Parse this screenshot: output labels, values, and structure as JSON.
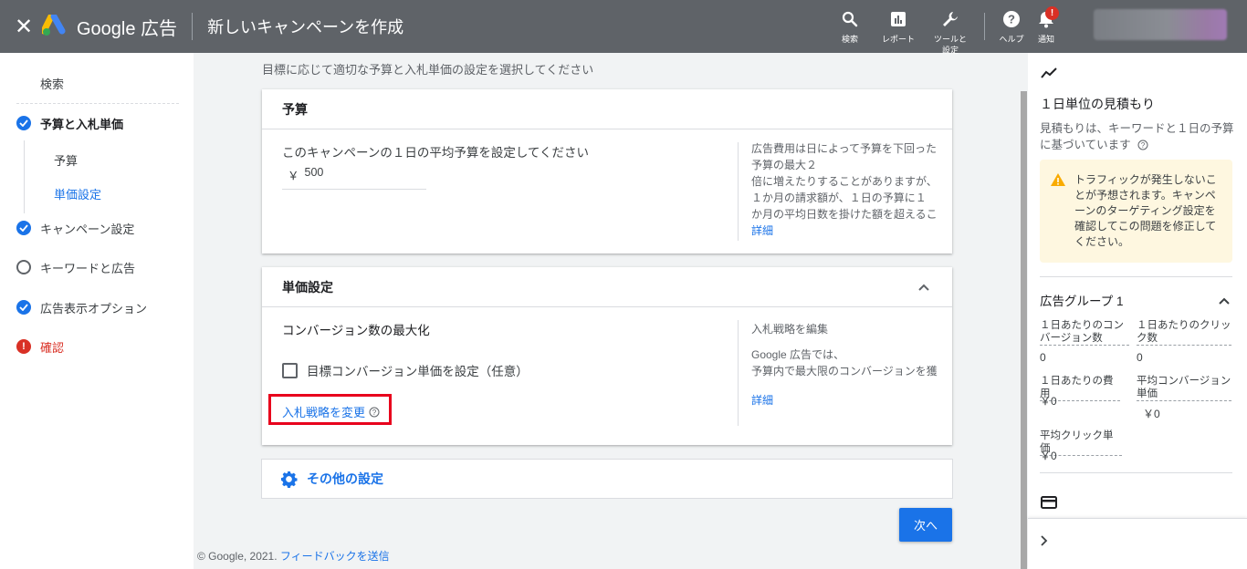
{
  "header": {
    "close_label": "✕",
    "brand": "Google 広告",
    "title": "新しいキャンペーンを作成",
    "tools": [
      {
        "label": "検索",
        "icon": "search-icon"
      },
      {
        "label": "レポート",
        "icon": "reports-icon"
      },
      {
        "label": "ツールと\n設定",
        "icon": "wrench-icon"
      },
      {
        "label": "ヘルプ",
        "icon": "help-icon"
      },
      {
        "label": "通知",
        "icon": "bell-icon"
      }
    ],
    "notification_badge": "!"
  },
  "sidebar": {
    "items": [
      {
        "label": "検索",
        "state": "none"
      },
      {
        "label": "予算と入札単価",
        "state": "done"
      },
      {
        "label": "予算",
        "state": "sub"
      },
      {
        "label": "単価設定",
        "state": "sub-active"
      },
      {
        "label": "キャンペーン設定",
        "state": "done"
      },
      {
        "label": "キーワードと広告",
        "state": "empty"
      },
      {
        "label": "広告表示オプション",
        "state": "done"
      },
      {
        "label": "確認",
        "state": "error"
      }
    ],
    "error_mark": "!"
  },
  "main": {
    "subtitle": "目標に応じて適切な予算と入札単価の設定を選択してください",
    "budget": {
      "title": "予算",
      "prompt": "このキャンペーンの１日の平均予算を設定してください",
      "currency": "￥",
      "value": "500",
      "note_lines": [
        "広告費用は日によって予算を下回った",
        "予算の最大２",
        "倍に増えたりすることがありますが、",
        "１か月の請求額が、１日の予算に１",
        "か月の平均日数を掛けた額を超えるこ"
      ],
      "note_link": "詳細"
    },
    "bidding": {
      "title": "単価設定",
      "strategy": "コンバージョン数の最大化",
      "checkbox_label": "目標コンバージョン単価を設定（任意）",
      "change_link": "入札戦略を変更",
      "note_title": "入札戦略を編集",
      "note_lines": [
        "Google 広告では、",
        "予算内で最大限のコンバージョンを獲"
      ],
      "note_link": "詳細"
    },
    "other_settings": "その他の設定",
    "next_button": "次へ",
    "footer_copyright": "© Google, 2021.",
    "footer_feedback": "フィードバックを送信"
  },
  "right_panel": {
    "title": "１日単位の見積もり",
    "description": "見積もりは、キーワードと１日の予算に基づいています",
    "warning": "トラフィックが発生しないことが予想されます。キャンペーンのターゲティング設定を確認してこの問題を修正してください。",
    "group_title": "広告グループ 1",
    "metrics": [
      {
        "label": "１日あたりのコンバージョン数",
        "value": "0"
      },
      {
        "label": "１日あたりのクリック数",
        "value": "0"
      },
      {
        "label": "１日あたりの費用",
        "value": "￥0"
      },
      {
        "label": "平均コンバージョン単価",
        "value": "￥0"
      },
      {
        "label": "平均クリック単価",
        "value": "￥0"
      }
    ]
  },
  "colors": {
    "header_bg": "#5f6368",
    "accent": "#1a73e8",
    "error": "#d93025",
    "highlight_box": "#e8001c",
    "warning_bg": "#fef7e0"
  }
}
